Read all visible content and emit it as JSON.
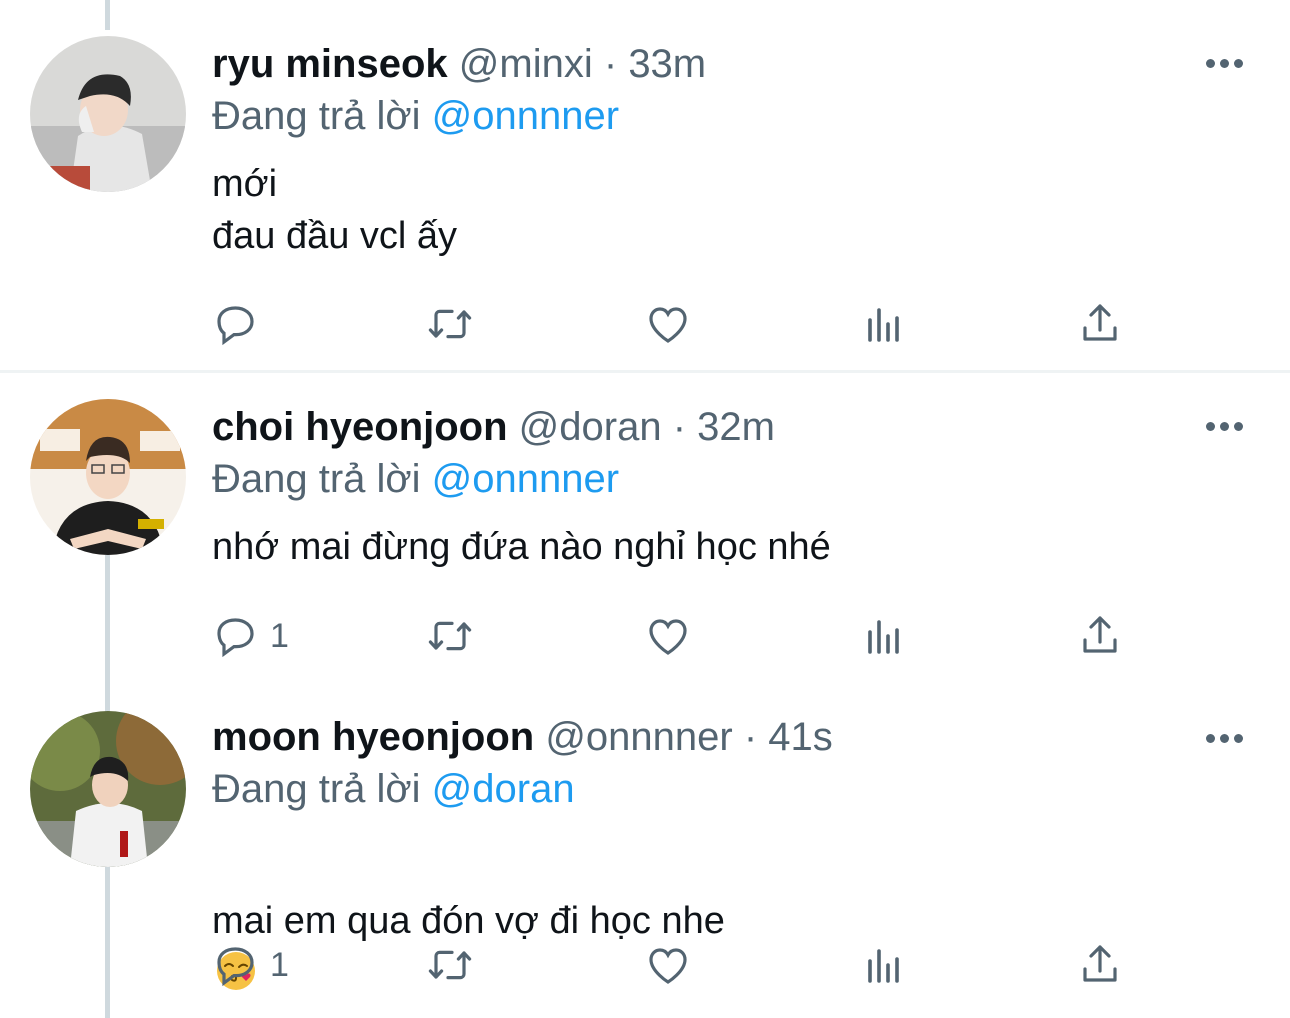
{
  "tweets": [
    {
      "name": "ryu minseok",
      "handle": "@minxi",
      "sep": "·",
      "time": "33m",
      "reply_prefix": "Đang trả lời",
      "reply_to": "@onnnner",
      "text": "mới\nđau đầu vcl ấy",
      "reply_count": ""
    },
    {
      "name": "choi hyeonjoon",
      "handle": "@doran",
      "sep": "·",
      "time": "32m",
      "reply_prefix": "Đang trả lời",
      "reply_to": "@onnnner",
      "text": "nhớ mai đừng đứa nào nghỉ học nhé",
      "reply_count": "1"
    },
    {
      "name": "moon hyeonjoon",
      "handle": "@onnnner",
      "sep": "·",
      "time": "41s",
      "reply_prefix": "Đang trả lời",
      "reply_to": "@doran",
      "text": "mai em qua đón vợ đi học nhe",
      "emoji": "face-blowing-a-kiss",
      "reply_count": "1"
    }
  ],
  "icons": {
    "reply": "reply-icon",
    "retweet": "retweet-icon",
    "like": "heart-icon",
    "views": "analytics-icon",
    "share": "share-icon",
    "more": "more-icon"
  },
  "colors": {
    "mention": "#1d9bf0",
    "secondary_text": "#536471",
    "thread_line": "#cfd9de"
  }
}
